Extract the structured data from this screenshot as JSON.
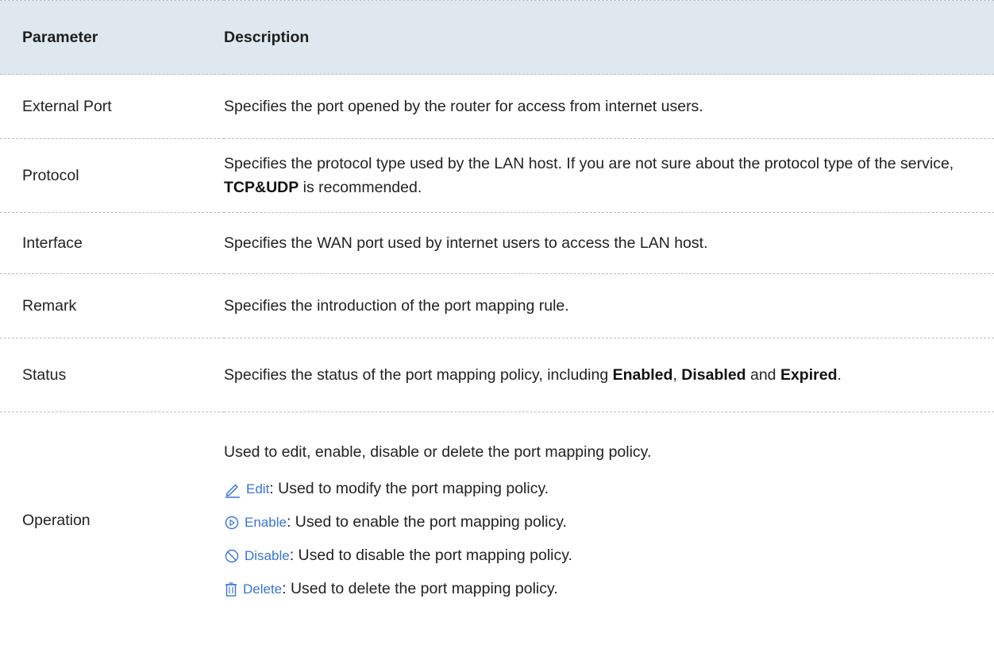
{
  "header": {
    "parameter": "Parameter",
    "description": "Description"
  },
  "rows": [
    {
      "param": "External Port",
      "desc": "Specifies the port opened by the router for access from internet users."
    },
    {
      "param": "Protocol",
      "desc_a": "Specifies the protocol type used by the LAN host. If you are not sure about the protocol type of the service, ",
      "desc_bold": "TCP&UDP",
      "desc_b": " is recommended."
    },
    {
      "param": "Interface",
      "desc": "Specifies the WAN port used by internet users to access the LAN host."
    },
    {
      "param": "Remark",
      "desc": "Specifies the introduction of the port mapping rule."
    },
    {
      "param": "Status",
      "desc_a": "Specifies the status of the port mapping policy, including ",
      "bold1": "Enabled",
      "sep1": ", ",
      "bold2": "Disabled",
      "sep2": " and ",
      "bold3": "Expired",
      "end": "."
    },
    {
      "param": "Operation",
      "desc_intro": "Used to edit, enable, disable or delete the port mapping policy."
    }
  ],
  "operations": [
    {
      "icon": "pencil-icon",
      "label": "Edit",
      "text": ": Used to modify the port mapping policy."
    },
    {
      "icon": "play-circle-icon",
      "label": "Enable",
      "text": ": Used to enable the port mapping policy."
    },
    {
      "icon": "prohibited-icon",
      "label": "Disable",
      "text": ": Used to disable the port mapping policy."
    },
    {
      "icon": "trash-icon",
      "label": "Delete",
      "text": ": Used to delete the port mapping policy."
    }
  ],
  "colors": {
    "header_bg": "#dfe8ef",
    "icon_blue": "#3a74d8",
    "divider": "#bdbdbd"
  }
}
